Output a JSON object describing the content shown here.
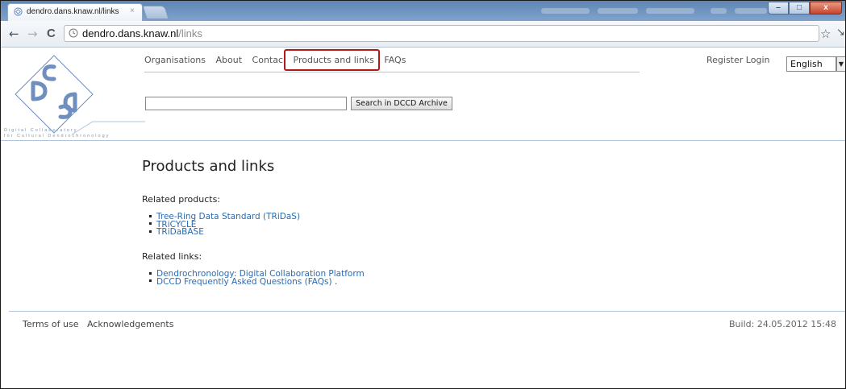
{
  "browser": {
    "tab_title": "dendro.dans.knaw.nl/links",
    "tab_close": "×",
    "back_glyph": "←",
    "forward_glyph": "→",
    "reload_glyph": "C",
    "url_host": "dendro.dans.knaw.nl",
    "url_path": "/links",
    "star_glyph": "☆",
    "wrench_glyph": "↘",
    "window_buttons": {
      "minimize": "–",
      "maximize": "□",
      "close": "x"
    }
  },
  "logo": {
    "line1": "Digital         Collaboratory",
    "line2": "for Cultural Dendrochronology"
  },
  "nav": {
    "items": [
      "Organisations",
      "About",
      "Contac",
      "Products and links",
      "FAQs"
    ],
    "register": "Register",
    "login": "Login",
    "language": "English",
    "lang_arrow": "▼"
  },
  "search": {
    "value": "",
    "button_label": "Search in DCCD Archive"
  },
  "content": {
    "title": "Products and links",
    "related_products_label": "Related products:",
    "related_products": [
      "Tree-Ring Data Standard (TRiDaS)",
      "TRiCYCLE",
      "TRiDaBASE"
    ],
    "related_links_label": "Related links:",
    "related_links": [
      "Dendrochronology: Digital Collaboration Platform",
      "DCCD Frequently Asked Questions (FAQs)"
    ],
    "related_links_suffix": " ."
  },
  "footer": {
    "terms": "Terms of use",
    "acknowledgements": "Acknowledgements",
    "build": "Build: 24.05.2012 15:48"
  },
  "colors": {
    "link": "#2a6bb0",
    "highlight": "#b21a1a",
    "rule": "#aec4da",
    "logo": "#6f8fbf"
  }
}
